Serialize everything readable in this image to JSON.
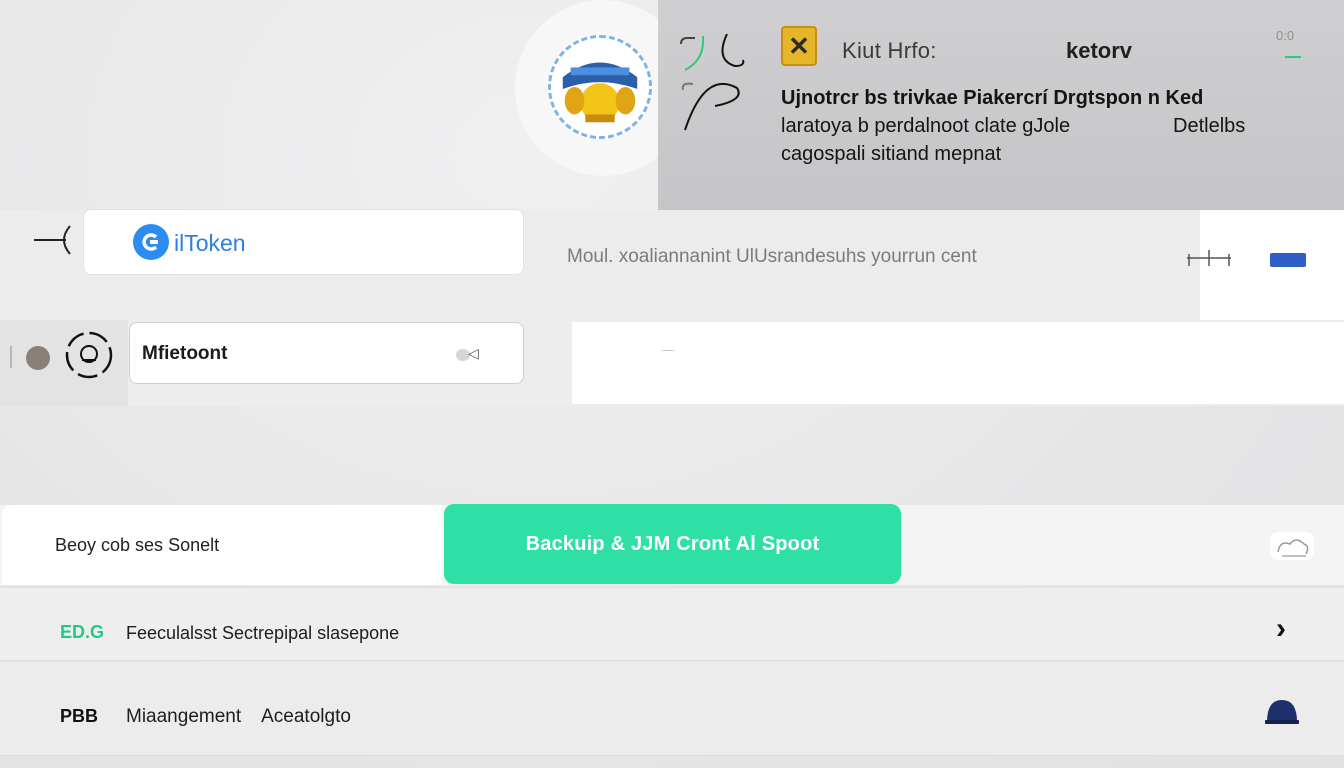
{
  "info": {
    "title": "Kiut Hrfo:",
    "tag": "ketorv",
    "toggle": "0:0",
    "line1": "Ujnotrcr bs trivkae Piakercrí Drgtspon n Ked",
    "line2": "laratoya b perdalnoot clate gJole",
    "line2_tail": "Detlelbs",
    "line3": "cagospali sitiand mepnat",
    "badge_color": "#e6b52a"
  },
  "wallet": {
    "name": "ilToken",
    "subtitle": "Moul.  xoaliannanint  UlUsrandesuhs yourrun  cent",
    "brand_color": "#2d8cf0"
  },
  "account": {
    "label": "Mfietoont"
  },
  "actions": {
    "backup_label": "Beoy cob  ses Sonelt",
    "backup_button": "Backuip &  JJM Cront   Al  Spoot",
    "button_color": "#2fe0a6",
    "row1_code": "ED.G",
    "row1_text": "Feeculalsst Sectrepipal slasepone",
    "row2_code": "PBB",
    "row2_text1": "Miaangement",
    "row2_text2": "Aceatolgto"
  }
}
